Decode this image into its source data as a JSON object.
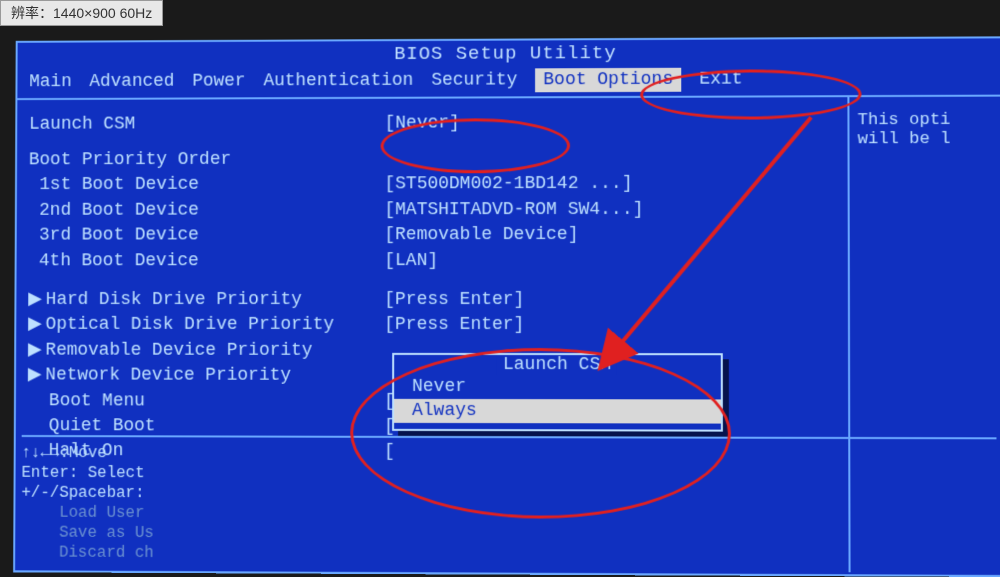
{
  "monitor_label": "辨率：1440×900 60Hz",
  "title": "BIOS Setup Utility",
  "menu": {
    "items": [
      "Main",
      "Advanced",
      "Power",
      "Authentication",
      "Security",
      "Boot Options",
      "Exit"
    ],
    "active": "Boot Options"
  },
  "launch_csm": {
    "label": "Launch CSM",
    "value": "[Never]"
  },
  "boot_order": {
    "header": "Boot Priority Order",
    "items": [
      {
        "label": " 1st Boot Device",
        "value": "[ST500DM002-1BD142  ...]"
      },
      {
        "label": " 2nd Boot Device",
        "value": "[MATSHITADVD-ROM SW4...]"
      },
      {
        "label": " 3rd Boot Device",
        "value": "[Removable Device]"
      },
      {
        "label": " 4th Boot Device",
        "value": "[LAN]"
      }
    ]
  },
  "submenus": [
    {
      "label": "Hard Disk Drive Priority",
      "value": "[Press Enter]"
    },
    {
      "label": "Optical Disk Drive Priority",
      "value": "[Press Enter]"
    },
    {
      "label": "Removable Device Priority",
      "value": ""
    },
    {
      "label": "Network Device Priority",
      "value": ""
    }
  ],
  "extra_items": [
    {
      "label": "  Boot Menu",
      "value": "["
    },
    {
      "label": "  Quiet Boot",
      "value": "["
    },
    {
      "label": "  Halt On",
      "value": "["
    }
  ],
  "popup": {
    "title": "Launch CSM",
    "options": [
      "Never",
      "Always"
    ],
    "selected": "Always"
  },
  "help": {
    "line1": "This opti",
    "line2": "will be l"
  },
  "hints": {
    "l1": "↑↓←→:Move",
    "l2": "Enter: Select",
    "l3": "+/-/Spacebar:",
    "l4": "    Load User",
    "l5": "    Save as Us",
    "l6": "    Discard ch"
  }
}
